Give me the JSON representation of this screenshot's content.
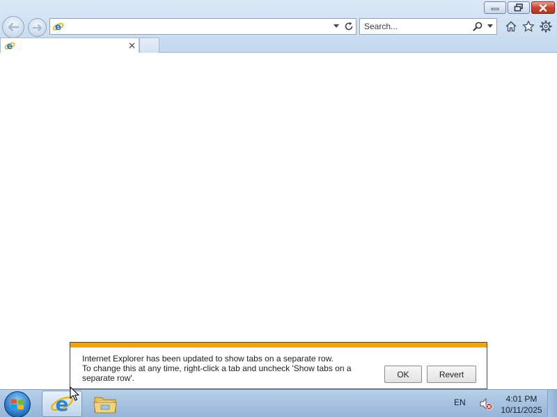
{
  "browser": {
    "address": {
      "value": ""
    },
    "search": {
      "placeholder": "Search..."
    },
    "tab": {
      "title": ""
    }
  },
  "notification": {
    "line1": "Internet Explorer has been updated to show tabs on a separate row.",
    "line2": "To change this at any time, right-click a tab and uncheck 'Show tabs on a",
    "line3": "separate row'.",
    "ok_label": "OK",
    "revert_label": "Revert",
    "accent_color": "#f0a30a"
  },
  "taskbar": {
    "language": "EN",
    "time": "4:01 PM",
    "date": "10/11/2025",
    "pinned": [
      "internet-explorer-icon",
      "windows-explorer-icon"
    ]
  },
  "icons": {
    "back": "back-arrow-icon",
    "forward": "forward-arrow-icon",
    "refresh": "refresh-icon",
    "search": "search-icon",
    "home": "home-icon",
    "favorites": "star-icon",
    "tools": "gear-icon",
    "volume": "volume-muted-icon"
  }
}
